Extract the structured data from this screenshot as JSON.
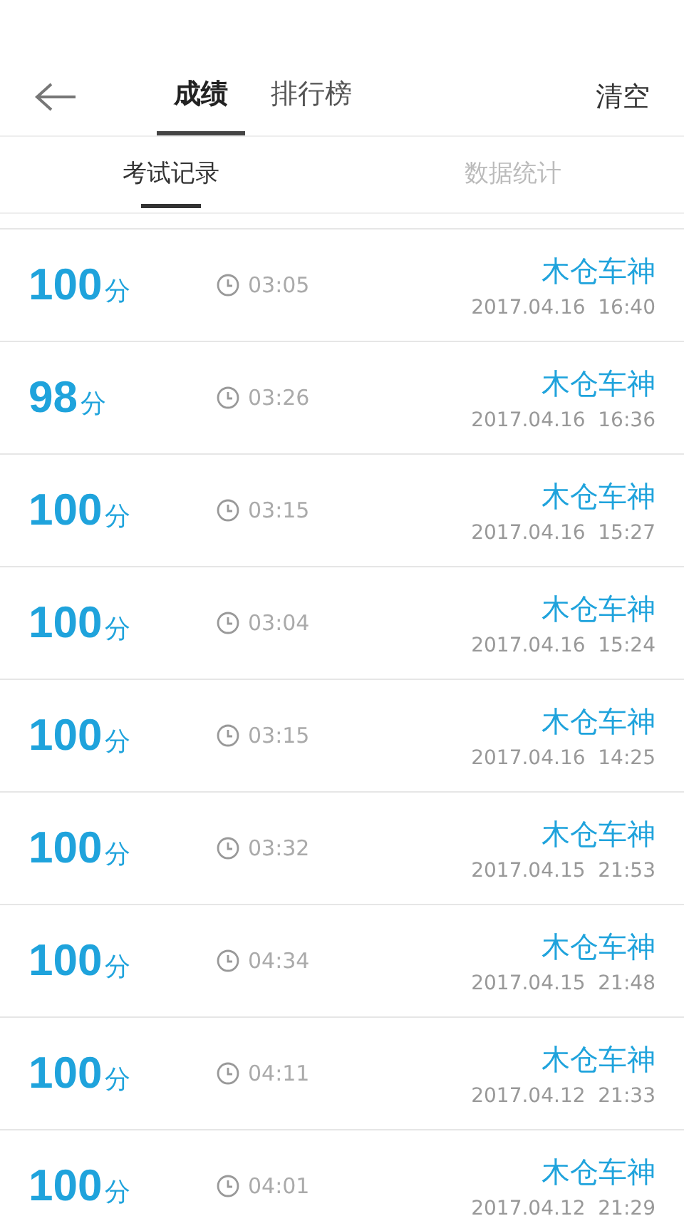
{
  "top_bar": {
    "tabs": [
      {
        "label": "成绩",
        "selected": true
      },
      {
        "label": "排行榜",
        "selected": false
      }
    ],
    "action": "清空"
  },
  "sub_tabs": [
    {
      "label": "考试记录",
      "selected": true
    },
    {
      "label": "数据统计",
      "selected": false
    }
  ],
  "records": [
    {
      "score": "100",
      "unit": "分",
      "duration": "03:05",
      "name": "木仓车神",
      "date": "2017.04.16  16:40"
    },
    {
      "score": "98",
      "unit": "分",
      "duration": "03:26",
      "name": "木仓车神",
      "date": "2017.04.16  16:36"
    },
    {
      "score": "100",
      "unit": "分",
      "duration": "03:15",
      "name": "木仓车神",
      "date": "2017.04.16  15:27"
    },
    {
      "score": "100",
      "unit": "分",
      "duration": "03:04",
      "name": "木仓车神",
      "date": "2017.04.16  15:24"
    },
    {
      "score": "100",
      "unit": "分",
      "duration": "03:15",
      "name": "木仓车神",
      "date": "2017.04.16  14:25"
    },
    {
      "score": "100",
      "unit": "分",
      "duration": "03:32",
      "name": "木仓车神",
      "date": "2017.04.15  21:53"
    },
    {
      "score": "100",
      "unit": "分",
      "duration": "04:34",
      "name": "木仓车神",
      "date": "2017.04.15  21:48"
    },
    {
      "score": "100",
      "unit": "分",
      "duration": "04:11",
      "name": "木仓车神",
      "date": "2017.04.12  21:33"
    },
    {
      "score": "100",
      "unit": "分",
      "duration": "04:01",
      "name": "木仓车神",
      "date": "2017.04.12  21:29"
    }
  ]
}
